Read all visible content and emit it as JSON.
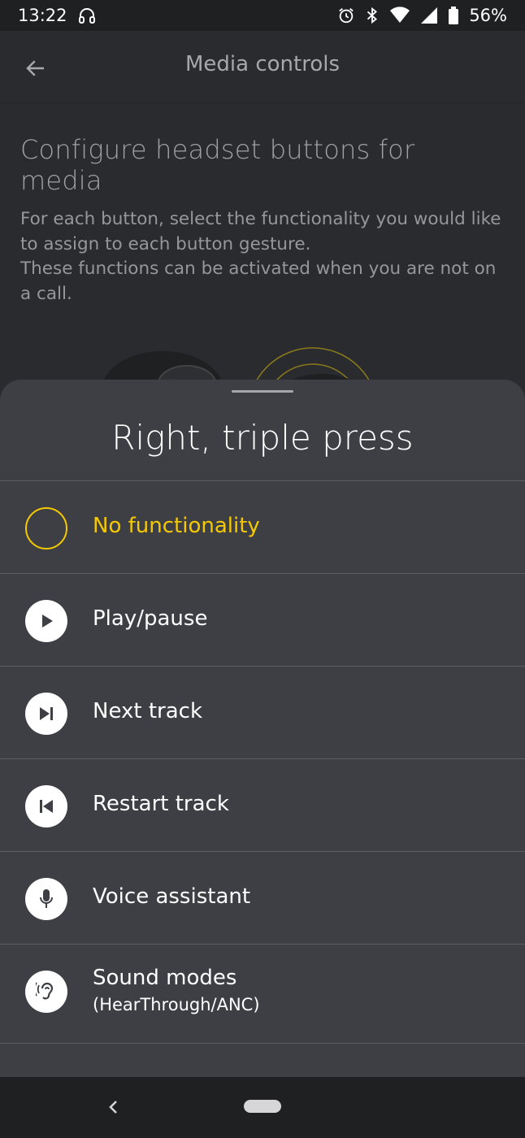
{
  "status_bar": {
    "time": "13:22",
    "battery": "56%",
    "icons": [
      "headphones-icon",
      "alarm-icon",
      "bluetooth-icon",
      "wifi-icon",
      "signal-icon",
      "battery-icon"
    ]
  },
  "app_bar": {
    "title": "Media controls",
    "back_icon": "arrow-back-icon"
  },
  "background_content": {
    "heading": "Configure headset buttons for media",
    "description_line1": "For each button, select the functionality you would like to assign to each button gesture.",
    "description_line2": "These functions can be activated when you are not on a call."
  },
  "sheet": {
    "title": "Right, triple press",
    "options": [
      {
        "label": "No functionality",
        "icon": "empty-radio-icon",
        "selected": true
      },
      {
        "label": "Play/pause",
        "icon": "play-icon",
        "selected": false
      },
      {
        "label": "Next track",
        "icon": "next-track-icon",
        "selected": false
      },
      {
        "label": "Restart track",
        "icon": "restart-track-icon",
        "selected": false
      },
      {
        "label": "Voice assistant",
        "icon": "microphone-icon",
        "selected": false
      },
      {
        "label": "Sound modes",
        "sublabel": "(HearThrough/ANC)",
        "icon": "ear-icon",
        "selected": false
      }
    ]
  },
  "colors": {
    "accent": "#f5c900",
    "sheet_bg": "#3e3f45",
    "page_bg": "#2a2b2e"
  }
}
